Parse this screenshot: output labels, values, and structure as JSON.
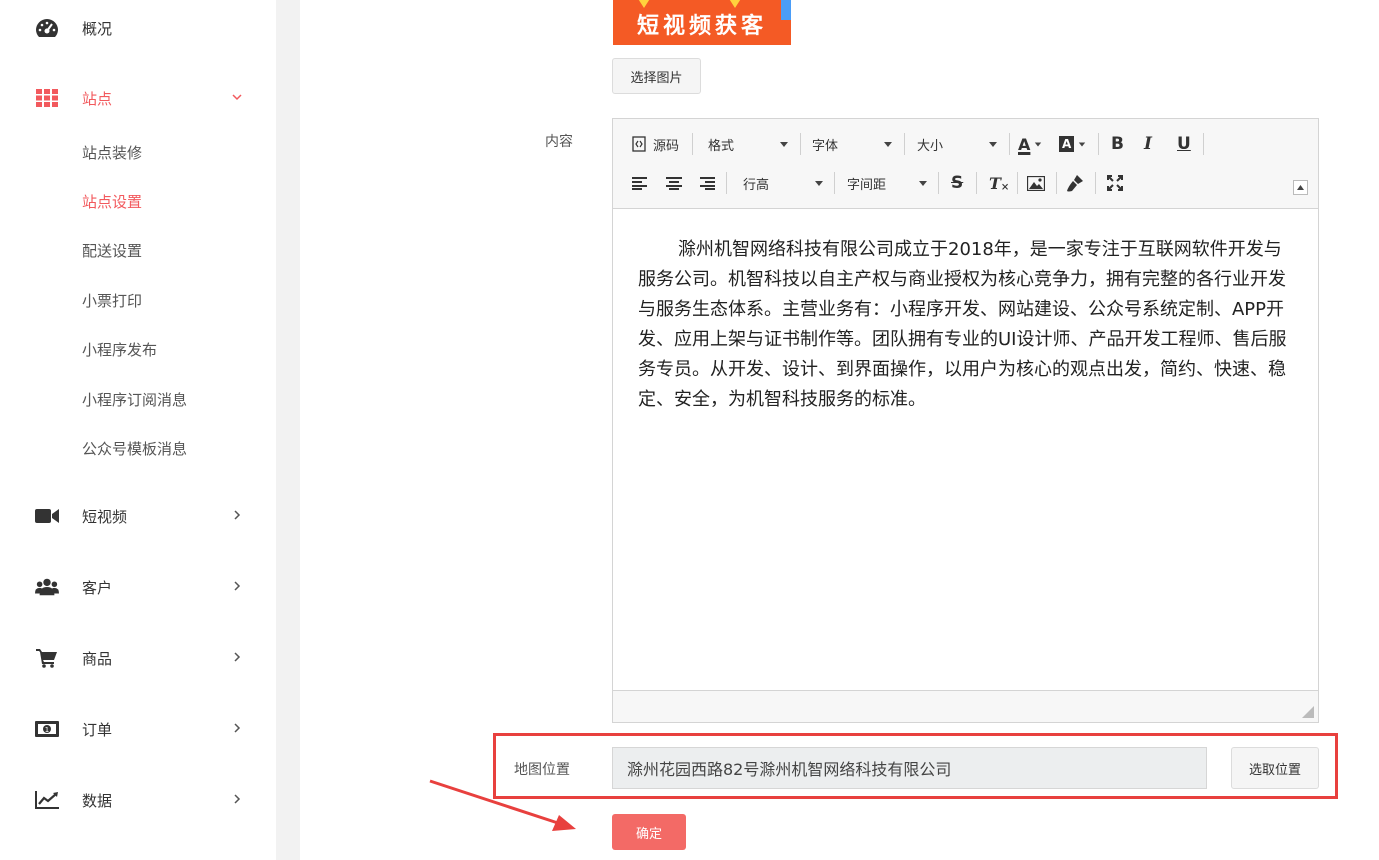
{
  "sidebar": {
    "menu": [
      {
        "label": "概况",
        "icon": "dashboard-gauge-icon"
      },
      {
        "label": "站点",
        "icon": "grid-apps-icon",
        "expanded": true,
        "active": true
      },
      {
        "label": "短视频",
        "icon": "video-camera-icon"
      },
      {
        "label": "客户",
        "icon": "users-icon"
      },
      {
        "label": "商品",
        "icon": "shopping-cart-icon"
      },
      {
        "label": "订单",
        "icon": "money-bill-icon"
      },
      {
        "label": "数据",
        "icon": "line-chart-icon"
      }
    ],
    "submenu": [
      {
        "label": "站点装修"
      },
      {
        "label": "站点设置",
        "active": true
      },
      {
        "label": "配送设置"
      },
      {
        "label": "小票打印"
      },
      {
        "label": "小程序发布"
      },
      {
        "label": "小程序订阅消息"
      },
      {
        "label": "公众号模板消息"
      }
    ]
  },
  "form": {
    "banner_text": "短视频获客",
    "select_image_button": "选择图片",
    "content_label": "内容",
    "editor": {
      "source_label": "源码",
      "format_label": "格式",
      "font_label": "字体",
      "size_label": "大小",
      "line_height_label": "行高",
      "letter_spacing_label": "字间距",
      "text_color_glyph": "A",
      "bg_color_glyph": "A",
      "bold_glyph": "B",
      "italic_glyph": "I",
      "underline_glyph": "U",
      "strike_glyph": "S",
      "clear_format_glyph": "T",
      "body": "滁州机智网络科技有限公司成立于2018年，是一家专注于互联网软件开发与服务公司。机智科技以自主产权与商业授权为核心竞争力，拥有完整的各行业开发与服务生态体系。主营业务有：小程序开发、网站建设、公众号系统定制、APP开发、应用上架与证书制作等。团队拥有专业的UI设计师、产品开发工程师、售后服务专员。从开发、设计、到界面操作，以用户为核心的观点出发，简约、快速、稳定、安全，为机智科技服务的标准。"
    },
    "map_label": "地图位置",
    "map_value": "滁州花园西路82号滁州机智网络科技有限公司",
    "pick_location_button": "选取位置",
    "confirm_button": "确定"
  },
  "colors": {
    "accent": "#f2595d",
    "highlight": "#e8403e",
    "confirm": "#f36a66"
  }
}
